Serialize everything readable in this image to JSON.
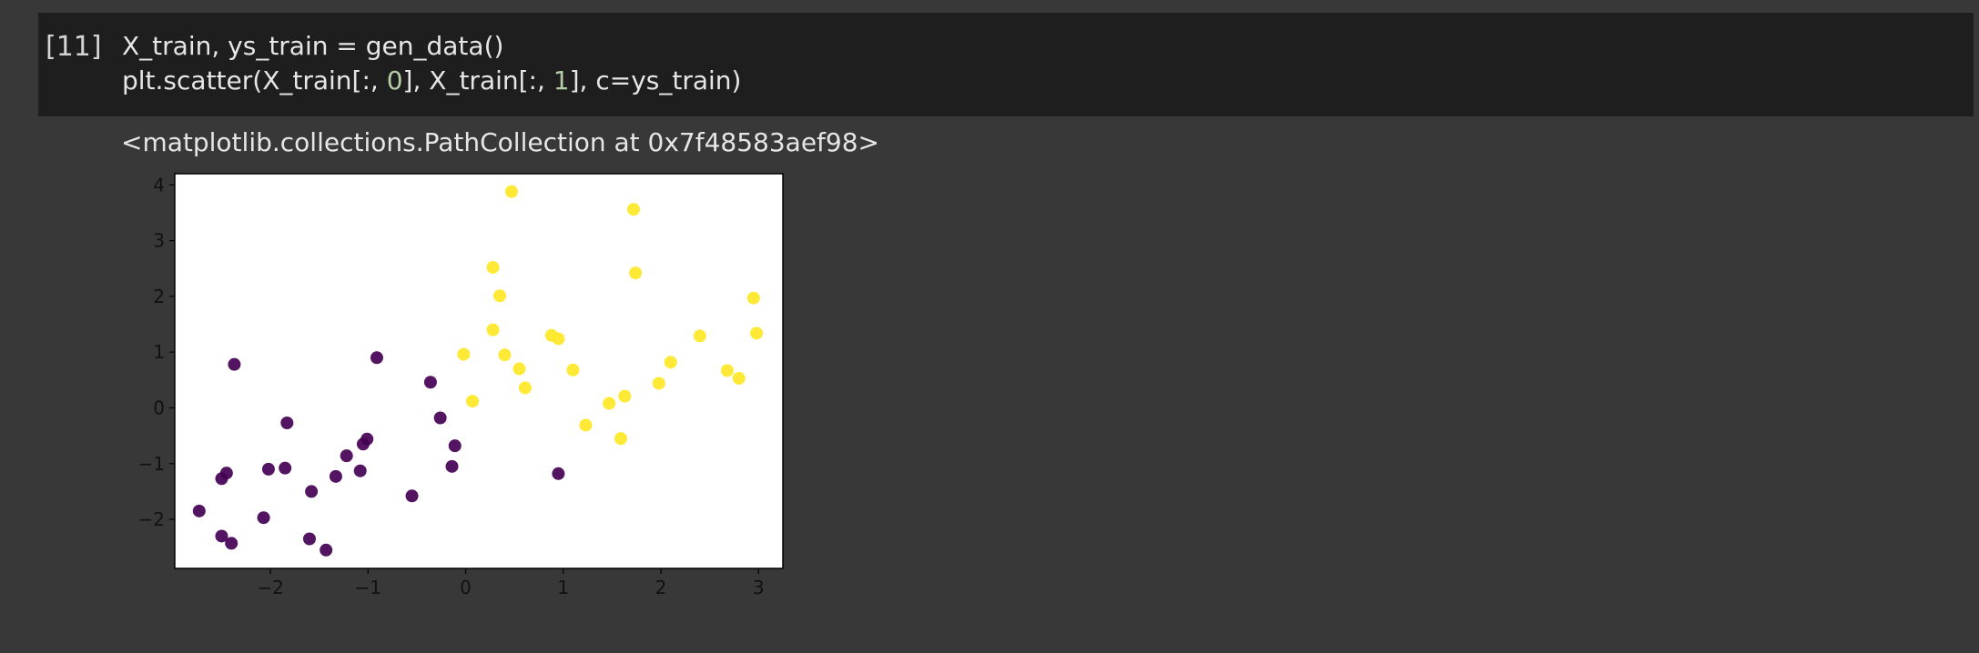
{
  "cell": {
    "prompt": "[11]",
    "code_lines": [
      [
        {
          "t": "X_train, ys_train = gen_data()",
          "k": "txt"
        }
      ],
      [
        {
          "t": "plt.scatter(X_train[:, ",
          "k": "txt"
        },
        {
          "t": "0",
          "k": "num"
        },
        {
          "t": "], X_train[:, ",
          "k": "txt"
        },
        {
          "t": "1",
          "k": "num"
        },
        {
          "t": "], c=ys_train)",
          "k": "txt"
        }
      ]
    ]
  },
  "output": {
    "repr_text": "<matplotlib.collections.PathCollection at 0x7f48583aef98>"
  },
  "colors": {
    "class0": "#440154",
    "class1": "#fde725",
    "axes_bg": "#ffffff"
  },
  "chart_data": {
    "type": "scatter",
    "xlim": [
      -2.98,
      3.25
    ],
    "ylim": [
      -2.88,
      4.2
    ],
    "xticks": [
      -2,
      -1,
      0,
      1,
      2,
      3
    ],
    "yticks": [
      -2,
      -1,
      0,
      1,
      2,
      3,
      4
    ],
    "xtick_labels": [
      "−2",
      "−1",
      "0",
      "1",
      "2",
      "3"
    ],
    "ytick_labels": [
      "−2",
      "−1",
      "0",
      "1",
      "2",
      "3",
      "4"
    ],
    "grid": false,
    "series": [
      {
        "points": [
          [
            -2.73,
            -1.85
          ],
          [
            -2.5,
            -2.3
          ],
          [
            -2.4,
            -2.43
          ],
          [
            -2.5,
            -1.27
          ],
          [
            -2.45,
            -1.17
          ],
          [
            -2.37,
            0.78
          ],
          [
            -2.07,
            -1.97
          ],
          [
            -2.02,
            -1.1
          ],
          [
            -1.85,
            -1.08
          ],
          [
            -1.83,
            -0.27
          ],
          [
            -1.6,
            -2.35
          ],
          [
            -1.58,
            -1.5
          ],
          [
            -1.43,
            -2.55
          ],
          [
            -1.33,
            -1.23
          ],
          [
            -1.22,
            -0.86
          ],
          [
            -1.08,
            -1.13
          ],
          [
            -1.05,
            -0.65
          ],
          [
            -1.01,
            -0.56
          ],
          [
            -0.91,
            0.9
          ],
          [
            -0.55,
            -1.58
          ],
          [
            -0.36,
            0.46
          ],
          [
            -0.26,
            -0.18
          ],
          [
            -0.14,
            -1.05
          ],
          [
            -0.11,
            -0.68
          ],
          [
            0.95,
            -1.18
          ]
        ]
      },
      {
        "points": [
          [
            0.47,
            3.88
          ],
          [
            1.72,
            3.56
          ],
          [
            0.28,
            2.52
          ],
          [
            0.35,
            2.01
          ],
          [
            1.74,
            2.42
          ],
          [
            2.95,
            1.97
          ],
          [
            0.28,
            1.4
          ],
          [
            0.88,
            1.3
          ],
          [
            0.95,
            1.24
          ],
          [
            2.4,
            1.29
          ],
          [
            2.98,
            1.34
          ],
          [
            -0.02,
            0.96
          ],
          [
            0.4,
            0.95
          ],
          [
            0.55,
            0.7
          ],
          [
            1.1,
            0.68
          ],
          [
            2.1,
            0.82
          ],
          [
            2.68,
            0.67
          ],
          [
            2.8,
            0.53
          ],
          [
            1.98,
            0.44
          ],
          [
            0.61,
            0.36
          ],
          [
            0.07,
            0.12
          ],
          [
            1.63,
            0.21
          ],
          [
            1.47,
            0.08
          ],
          [
            1.23,
            -0.31
          ],
          [
            1.59,
            -0.55
          ]
        ]
      }
    ]
  }
}
